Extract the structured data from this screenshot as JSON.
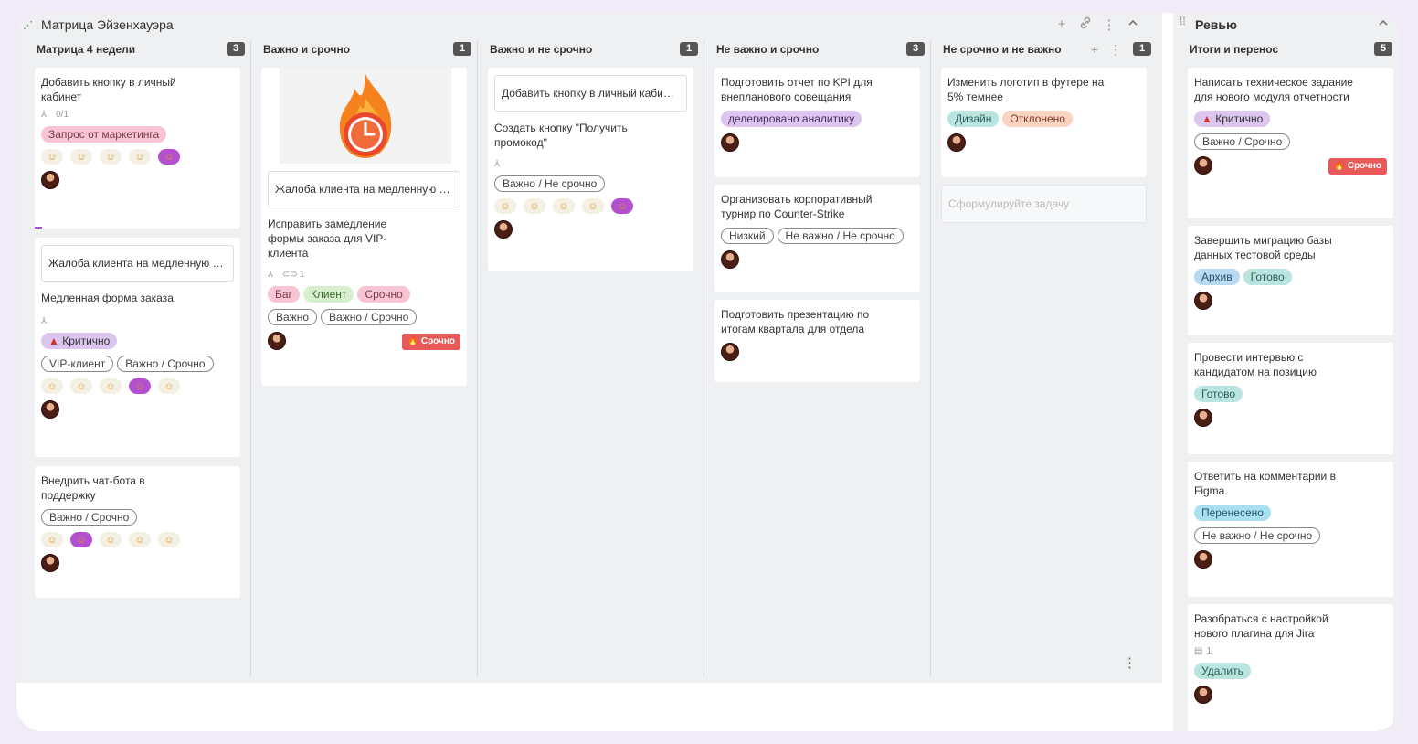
{
  "board": {
    "title": "Матрица Эйзенхауэра",
    "columns": [
      {
        "name": "Матрица 4 недели",
        "count": "3",
        "cards": [
          {
            "title": "Добавить кнопку в личный кабинет",
            "subtasks": "0/1",
            "labels": [
              "Запрос от маркетинга"
            ]
          },
          {
            "embed": "Жалоба клиента на медленную форму заказа",
            "title": "Медленная форма заказа",
            "critical": "Критично",
            "tags": [
              "VIP-клиент",
              "Важно / Срочно"
            ]
          },
          {
            "title": "Внедрить чат-бота в поддержку",
            "tags": [
              "Важно / Срочно"
            ]
          }
        ]
      },
      {
        "name": "Важно и срочно",
        "count": "1",
        "cards": [
          {
            "embed": "Жалоба клиента на медленную форму заказа",
            "title": "Исправить замедление формы заказа для VIP-клиента",
            "attachments": "1",
            "labels": [
              "Баг",
              "Клиент",
              "Срочно"
            ],
            "tags": [
              "Важно",
              "Важно / Срочно"
            ],
            "badge": "Срочно"
          }
        ]
      },
      {
        "name": "Важно и не срочно",
        "count": "1",
        "cards": [
          {
            "embed": "Добавить кнопку в личный кабинет",
            "title": "Создать кнопку \"Получить промокод\"",
            "tags": [
              "Важно / Не срочно"
            ]
          }
        ]
      },
      {
        "name": "Не важно и срочно",
        "count": "3",
        "cards": [
          {
            "title": "Подготовить отчет по KPI для внепланового совещания",
            "labels": [
              "делегировано аналитику"
            ]
          },
          {
            "title": "Организовать корпоративный турнир по Counter-Strike",
            "tags": [
              "Низкий",
              "Не важно / Не срочно"
            ]
          },
          {
            "title": "Подготовить презентацию по итогам квартала для отдела"
          }
        ]
      },
      {
        "name": "Не срочно и не важно",
        "count": "1",
        "cards": [
          {
            "title": "Изменить логотип в футере на 5% темнее",
            "labels": [
              "Дизайн",
              "Отклонено"
            ]
          }
        ],
        "new_task_placeholder": "Сформулируйте задачу"
      }
    ]
  },
  "review": {
    "title": "Ревью",
    "column": {
      "name": "Итоги и перенос",
      "count": "5",
      "cards": [
        {
          "title": "Написать техническое задание для нового модуля отчетности",
          "critical": "Критично",
          "tags": [
            "Важно / Срочно"
          ],
          "badge": "Срочно"
        },
        {
          "title": "Завершить миграцию базы данных тестовой среды",
          "labels": [
            "Архив",
            "Готово"
          ]
        },
        {
          "title": "Провести интервью с кандидатом на позицию",
          "labels": [
            "Готово"
          ]
        },
        {
          "title": "Ответить на комментарии в Figma",
          "labels": [
            "Перенесено"
          ],
          "tags": [
            "Не важно / Не срочно"
          ]
        },
        {
          "title": "Разобраться с настройкой нового плагина для Jira",
          "comments": "1",
          "labels": [
            "Удалить"
          ]
        }
      ]
    }
  },
  "colors": {
    "accent": "#b44fcf",
    "urgent": "#e85a5a",
    "board_bg": "#eef0f2"
  },
  "icons": [
    "plus-icon",
    "link-icon",
    "more-icon",
    "chevron-up-icon",
    "fire-icon",
    "alarm-icon",
    "subtask-icon",
    "paperclip-icon",
    "comment-icon",
    "drag-handle-icon"
  ]
}
